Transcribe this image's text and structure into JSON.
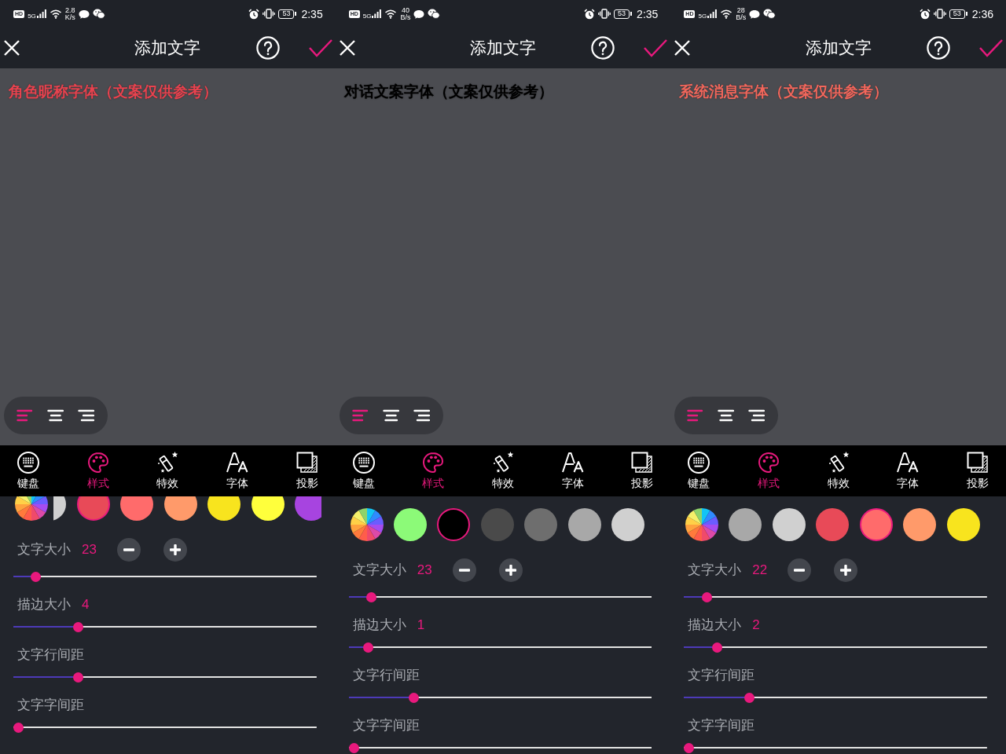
{
  "screens": [
    {
      "status_bar": {
        "hd": "HD",
        "network": "5G",
        "speed": "2.8",
        "speed_unit": "K/s",
        "battery": "53",
        "time": "2:35"
      },
      "header": {
        "title": "添加文字"
      },
      "sample_text": {
        "text": "角色昵称字体（文案仅供参考）",
        "color": "#e8434f"
      },
      "alignment": [
        {
          "kind": "left",
          "selected": true
        },
        {
          "kind": "center",
          "selected": false
        },
        {
          "kind": "right",
          "selected": false
        }
      ],
      "toolbar": [
        {
          "kind": "keyboard",
          "label": "键盘",
          "selected": false
        },
        {
          "kind": "style",
          "label": "样式",
          "selected": true
        },
        {
          "kind": "effects",
          "label": "特效",
          "selected": false
        },
        {
          "kind": "font",
          "label": "字体",
          "selected": false
        },
        {
          "kind": "shadow",
          "label": "投影",
          "selected": false
        }
      ],
      "style_panel": {
        "scrolled": true,
        "palette": {
          "scrolled": true,
          "swatches": [
            {
              "color": "#d0d0d0",
              "selected": false
            },
            {
              "color": "#e84a58",
              "selected": true
            },
            {
              "color": "#ff6b6b",
              "selected": false
            },
            {
              "color": "#ff9a6a",
              "selected": false
            },
            {
              "color": "#f8e41e",
              "selected": false
            },
            {
              "color": "#ffff3c",
              "selected": false
            },
            {
              "color": "#a744e0",
              "selected": false
            }
          ]
        },
        "settings": [
          {
            "kind": "stepper",
            "label": "文字大小",
            "value": "23",
            "level": 0.075
          },
          {
            "kind": "slider",
            "label": "描边大小",
            "value": "4",
            "level": 0.215
          },
          {
            "kind": "slider",
            "label": "文字行间距",
            "level": 0.215
          },
          {
            "kind": "slider",
            "label": "文字字间距",
            "level": 0
          }
        ]
      }
    },
    {
      "status_bar": {
        "hd": "HD",
        "network": "5G",
        "speed": "40",
        "speed_unit": "B/s",
        "battery": "53",
        "time": "2:35"
      },
      "header": {
        "title": "添加文字"
      },
      "sample_text": {
        "text": "对话文案字体（文案仅供参考）",
        "color": "#000000"
      },
      "alignment": [
        {
          "kind": "left",
          "selected": true
        },
        {
          "kind": "center",
          "selected": false
        },
        {
          "kind": "right",
          "selected": false
        }
      ],
      "toolbar": [
        {
          "kind": "keyboard",
          "label": "键盘",
          "selected": false
        },
        {
          "kind": "style",
          "label": "样式",
          "selected": true
        },
        {
          "kind": "effects",
          "label": "特效",
          "selected": false
        },
        {
          "kind": "font",
          "label": "字体",
          "selected": false
        },
        {
          "kind": "shadow",
          "label": "投影",
          "selected": false
        }
      ],
      "style_panel": {
        "scrolled": false,
        "palette": {
          "scrolled": false,
          "swatches": [
            {
              "color": "#8cfa78",
              "selected": false
            },
            {
              "color": "#000000",
              "selected": true
            },
            {
              "color": "#4a4a4a",
              "selected": false
            },
            {
              "color": "#6e6e6e",
              "selected": false
            },
            {
              "color": "#a8a8a8",
              "selected": false
            },
            {
              "color": "#d0d0d0",
              "selected": false
            }
          ]
        },
        "settings": [
          {
            "kind": "stepper",
            "label": "文字大小",
            "value": "23",
            "level": 0.075
          },
          {
            "kind": "slider",
            "label": "描边大小",
            "value": "1",
            "level": 0.065
          },
          {
            "kind": "slider",
            "label": "文字行间距",
            "level": 0.215
          },
          {
            "kind": "slider",
            "label": "文字字间距",
            "level": 0
          }
        ]
      }
    },
    {
      "status_bar": {
        "hd": "HD",
        "network": "5G",
        "speed": "28",
        "speed_unit": "B/s",
        "battery": "53",
        "time": "2:36"
      },
      "header": {
        "title": "添加文字"
      },
      "sample_text": {
        "text": "系统消息字体（文案仅供参考）",
        "color": "#f2675c"
      },
      "alignment": [
        {
          "kind": "left",
          "selected": true
        },
        {
          "kind": "center",
          "selected": false
        },
        {
          "kind": "right",
          "selected": false
        }
      ],
      "toolbar": [
        {
          "kind": "keyboard",
          "label": "键盘",
          "selected": false
        },
        {
          "kind": "style",
          "label": "样式",
          "selected": true
        },
        {
          "kind": "effects",
          "label": "特效",
          "selected": false
        },
        {
          "kind": "font",
          "label": "字体",
          "selected": false
        },
        {
          "kind": "shadow",
          "label": "投影",
          "selected": false
        }
      ],
      "style_panel": {
        "scrolled": false,
        "palette": {
          "scrolled": false,
          "swatches": [
            {
              "color": "#a8a8a8",
              "selected": false
            },
            {
              "color": "#d0d0d0",
              "selected": false
            },
            {
              "color": "#e84a58",
              "selected": false
            },
            {
              "color": "#ff6b6b",
              "selected": true
            },
            {
              "color": "#ff9a6a",
              "selected": false
            },
            {
              "color": "#f8e41e",
              "selected": false
            }
          ]
        },
        "settings": [
          {
            "kind": "stepper",
            "label": "文字大小",
            "value": "22",
            "level": 0.075
          },
          {
            "kind": "slider",
            "label": "描边大小",
            "value": "2",
            "level": 0.11
          },
          {
            "kind": "slider",
            "label": "文字行间距",
            "level": 0.215
          },
          {
            "kind": "slider",
            "label": "文字字间距",
            "level": 0
          }
        ]
      }
    }
  ]
}
